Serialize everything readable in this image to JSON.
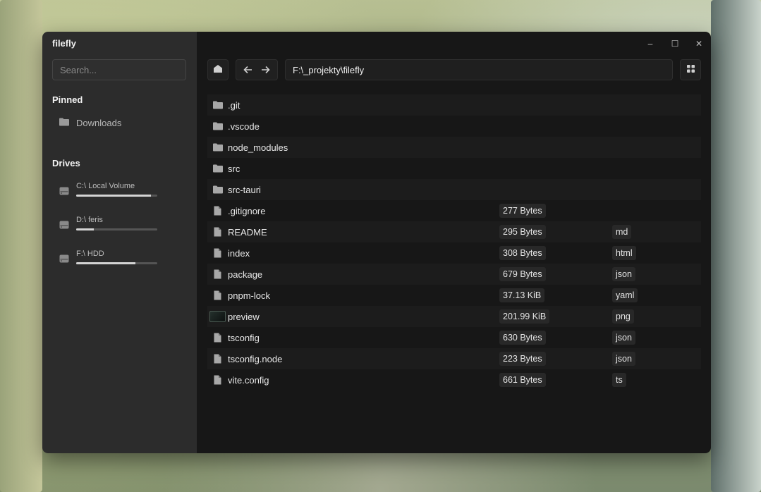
{
  "window": {
    "title": "filefly"
  },
  "sidebar": {
    "search_placeholder": "Search...",
    "pinned_title": "Pinned",
    "pinned": [
      {
        "label": "Downloads",
        "icon": "folder-icon"
      }
    ],
    "drives_title": "Drives",
    "drives": [
      {
        "label": "C:\\ Local Volume",
        "usage": 0.92,
        "icon": "drive-icon"
      },
      {
        "label": "D:\\ feris",
        "usage": 0.22,
        "icon": "drive-icon"
      },
      {
        "label": "F:\\ HDD",
        "usage": 0.73,
        "icon": "drive-icon"
      }
    ]
  },
  "toolbar": {
    "home_icon": "home-icon",
    "back_icon": "arrow-left-icon",
    "forward_icon": "arrow-right-icon",
    "path": "F:\\_projekty\\filefly",
    "view_icon": "grid-icon"
  },
  "window_controls": {
    "minimize": "–",
    "maximize": "☐",
    "close": "✕"
  },
  "files": [
    {
      "name": ".git",
      "type": "folder",
      "size": "",
      "ext": ""
    },
    {
      "name": ".vscode",
      "type": "folder",
      "size": "",
      "ext": ""
    },
    {
      "name": "node_modules",
      "type": "folder",
      "size": "",
      "ext": ""
    },
    {
      "name": "src",
      "type": "folder",
      "size": "",
      "ext": ""
    },
    {
      "name": "src-tauri",
      "type": "folder",
      "size": "",
      "ext": ""
    },
    {
      "name": ".gitignore",
      "type": "file",
      "size": "277 Bytes",
      "ext": ""
    },
    {
      "name": "README",
      "type": "file",
      "size": "295 Bytes",
      "ext": "md"
    },
    {
      "name": "index",
      "type": "file",
      "size": "308 Bytes",
      "ext": "html"
    },
    {
      "name": "package",
      "type": "file",
      "size": "679 Bytes",
      "ext": "json"
    },
    {
      "name": "pnpm-lock",
      "type": "file",
      "size": "37.13 KiB",
      "ext": "yaml"
    },
    {
      "name": "preview",
      "type": "image",
      "size": "201.99 KiB",
      "ext": "png"
    },
    {
      "name": "tsconfig",
      "type": "file",
      "size": "630 Bytes",
      "ext": "json"
    },
    {
      "name": "tsconfig.node",
      "type": "file",
      "size": "223 Bytes",
      "ext": "json"
    },
    {
      "name": "vite.config",
      "type": "file",
      "size": "661 Bytes",
      "ext": "ts"
    }
  ]
}
